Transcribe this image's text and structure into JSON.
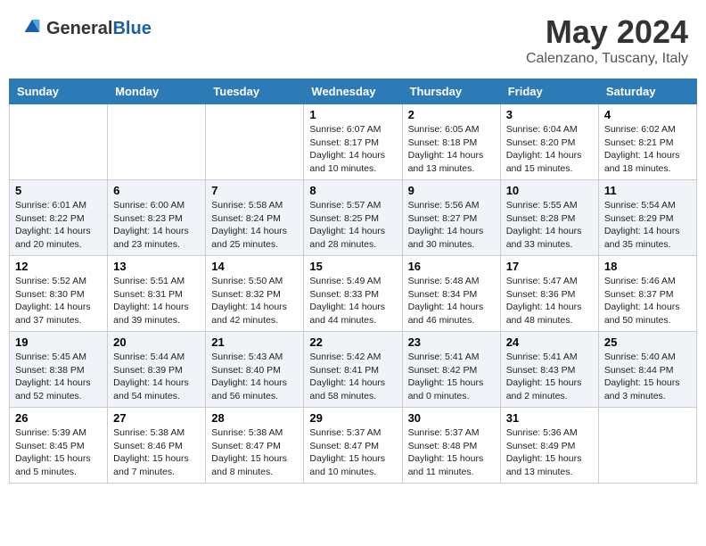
{
  "header": {
    "logo_general": "General",
    "logo_blue": "Blue",
    "month_title": "May 2024",
    "location": "Calenzano, Tuscany, Italy"
  },
  "weekdays": [
    "Sunday",
    "Monday",
    "Tuesday",
    "Wednesday",
    "Thursday",
    "Friday",
    "Saturday"
  ],
  "weeks": [
    [
      {
        "day": "",
        "info": ""
      },
      {
        "day": "",
        "info": ""
      },
      {
        "day": "",
        "info": ""
      },
      {
        "day": "1",
        "info": "Sunrise: 6:07 AM\nSunset: 8:17 PM\nDaylight: 14 hours and 10 minutes."
      },
      {
        "day": "2",
        "info": "Sunrise: 6:05 AM\nSunset: 8:18 PM\nDaylight: 14 hours and 13 minutes."
      },
      {
        "day": "3",
        "info": "Sunrise: 6:04 AM\nSunset: 8:20 PM\nDaylight: 14 hours and 15 minutes."
      },
      {
        "day": "4",
        "info": "Sunrise: 6:02 AM\nSunset: 8:21 PM\nDaylight: 14 hours and 18 minutes."
      }
    ],
    [
      {
        "day": "5",
        "info": "Sunrise: 6:01 AM\nSunset: 8:22 PM\nDaylight: 14 hours and 20 minutes."
      },
      {
        "day": "6",
        "info": "Sunrise: 6:00 AM\nSunset: 8:23 PM\nDaylight: 14 hours and 23 minutes."
      },
      {
        "day": "7",
        "info": "Sunrise: 5:58 AM\nSunset: 8:24 PM\nDaylight: 14 hours and 25 minutes."
      },
      {
        "day": "8",
        "info": "Sunrise: 5:57 AM\nSunset: 8:25 PM\nDaylight: 14 hours and 28 minutes."
      },
      {
        "day": "9",
        "info": "Sunrise: 5:56 AM\nSunset: 8:27 PM\nDaylight: 14 hours and 30 minutes."
      },
      {
        "day": "10",
        "info": "Sunrise: 5:55 AM\nSunset: 8:28 PM\nDaylight: 14 hours and 33 minutes."
      },
      {
        "day": "11",
        "info": "Sunrise: 5:54 AM\nSunset: 8:29 PM\nDaylight: 14 hours and 35 minutes."
      }
    ],
    [
      {
        "day": "12",
        "info": "Sunrise: 5:52 AM\nSunset: 8:30 PM\nDaylight: 14 hours and 37 minutes."
      },
      {
        "day": "13",
        "info": "Sunrise: 5:51 AM\nSunset: 8:31 PM\nDaylight: 14 hours and 39 minutes."
      },
      {
        "day": "14",
        "info": "Sunrise: 5:50 AM\nSunset: 8:32 PM\nDaylight: 14 hours and 42 minutes."
      },
      {
        "day": "15",
        "info": "Sunrise: 5:49 AM\nSunset: 8:33 PM\nDaylight: 14 hours and 44 minutes."
      },
      {
        "day": "16",
        "info": "Sunrise: 5:48 AM\nSunset: 8:34 PM\nDaylight: 14 hours and 46 minutes."
      },
      {
        "day": "17",
        "info": "Sunrise: 5:47 AM\nSunset: 8:36 PM\nDaylight: 14 hours and 48 minutes."
      },
      {
        "day": "18",
        "info": "Sunrise: 5:46 AM\nSunset: 8:37 PM\nDaylight: 14 hours and 50 minutes."
      }
    ],
    [
      {
        "day": "19",
        "info": "Sunrise: 5:45 AM\nSunset: 8:38 PM\nDaylight: 14 hours and 52 minutes."
      },
      {
        "day": "20",
        "info": "Sunrise: 5:44 AM\nSunset: 8:39 PM\nDaylight: 14 hours and 54 minutes."
      },
      {
        "day": "21",
        "info": "Sunrise: 5:43 AM\nSunset: 8:40 PM\nDaylight: 14 hours and 56 minutes."
      },
      {
        "day": "22",
        "info": "Sunrise: 5:42 AM\nSunset: 8:41 PM\nDaylight: 14 hours and 58 minutes."
      },
      {
        "day": "23",
        "info": "Sunrise: 5:41 AM\nSunset: 8:42 PM\nDaylight: 15 hours and 0 minutes."
      },
      {
        "day": "24",
        "info": "Sunrise: 5:41 AM\nSunset: 8:43 PM\nDaylight: 15 hours and 2 minutes."
      },
      {
        "day": "25",
        "info": "Sunrise: 5:40 AM\nSunset: 8:44 PM\nDaylight: 15 hours and 3 minutes."
      }
    ],
    [
      {
        "day": "26",
        "info": "Sunrise: 5:39 AM\nSunset: 8:45 PM\nDaylight: 15 hours and 5 minutes."
      },
      {
        "day": "27",
        "info": "Sunrise: 5:38 AM\nSunset: 8:46 PM\nDaylight: 15 hours and 7 minutes."
      },
      {
        "day": "28",
        "info": "Sunrise: 5:38 AM\nSunset: 8:47 PM\nDaylight: 15 hours and 8 minutes."
      },
      {
        "day": "29",
        "info": "Sunrise: 5:37 AM\nSunset: 8:47 PM\nDaylight: 15 hours and 10 minutes."
      },
      {
        "day": "30",
        "info": "Sunrise: 5:37 AM\nSunset: 8:48 PM\nDaylight: 15 hours and 11 minutes."
      },
      {
        "day": "31",
        "info": "Sunrise: 5:36 AM\nSunset: 8:49 PM\nDaylight: 15 hours and 13 minutes."
      },
      {
        "day": "",
        "info": ""
      }
    ]
  ]
}
